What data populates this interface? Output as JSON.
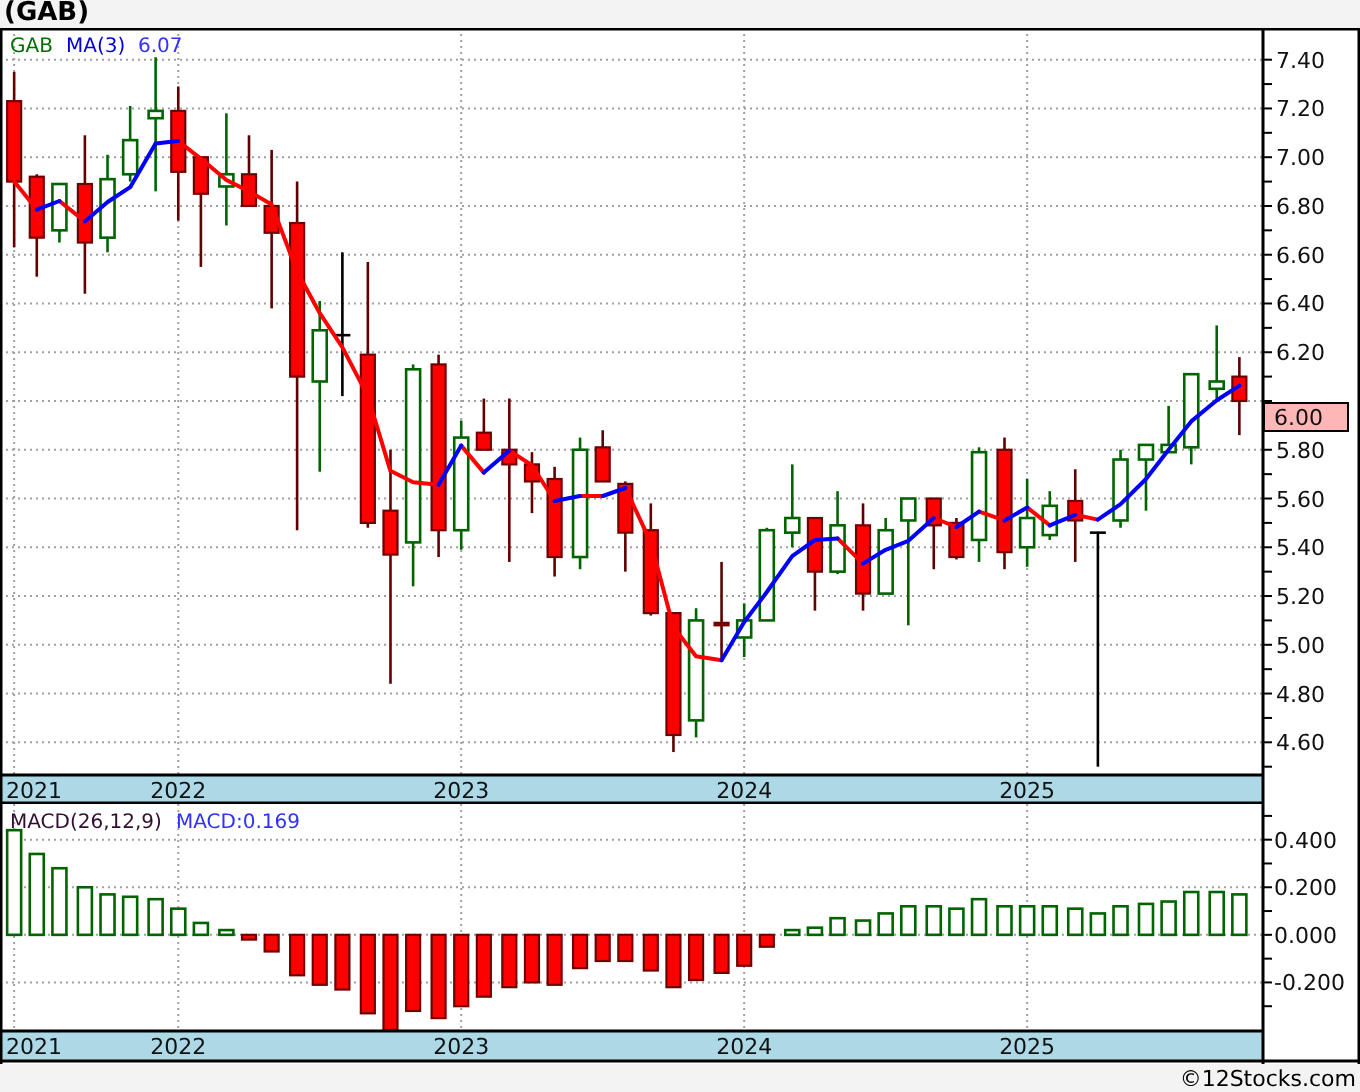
{
  "title": "(GAB)",
  "price_chart": {
    "legend": {
      "symbol": "GAB",
      "indicator": "MA(3)",
      "reading": "6.07"
    },
    "last_price": "6.00",
    "chart_data": {
      "type": "candlestick",
      "grid": true,
      "xlim": [
        2021.37,
        2025.83
      ],
      "ylim": [
        4.47,
        7.53
      ],
      "x": [
        2021.42,
        2021.5,
        2021.58,
        2021.67,
        2021.75,
        2021.83,
        2021.92,
        2022,
        2022.08,
        2022.17,
        2022.25,
        2022.33,
        2022.42,
        2022.5,
        2022.58,
        2022.67,
        2022.75,
        2022.83,
        2022.92,
        2023,
        2023.08,
        2023.17,
        2023.25,
        2023.33,
        2023.42,
        2023.5,
        2023.58,
        2023.67,
        2023.75,
        2023.83,
        2023.92,
        2024,
        2024.08,
        2024.17,
        2024.25,
        2024.33,
        2024.42,
        2024.5,
        2024.58,
        2024.67,
        2024.75,
        2024.83,
        2024.92,
        2025,
        2025.08,
        2025.17,
        2025.25,
        2025.33,
        2025.42,
        2025.5,
        2025.58,
        2025.67,
        2025.75
      ],
      "ohlc": [
        [
          7.23,
          7.35,
          6.63,
          6.9
        ],
        [
          6.92,
          6.93,
          6.51,
          6.67
        ],
        [
          6.7,
          6.89,
          6.65,
          6.89
        ],
        [
          6.89,
          7.09,
          6.44,
          6.65
        ],
        [
          6.67,
          7.01,
          6.61,
          6.91
        ],
        [
          6.93,
          7.21,
          6.9,
          7.07
        ],
        [
          7.16,
          7.41,
          6.86,
          7.19
        ],
        [
          7.19,
          7.29,
          6.74,
          6.94
        ],
        [
          7.0,
          7.0,
          6.55,
          6.85
        ],
        [
          6.88,
          7.18,
          6.72,
          6.93
        ],
        [
          6.93,
          7.09,
          6.8,
          6.8
        ],
        [
          6.8,
          7.03,
          6.38,
          6.69
        ],
        [
          6.73,
          6.9,
          5.47,
          6.1
        ],
        [
          6.08,
          6.41,
          5.71,
          6.29
        ],
        [
          6.27,
          6.61,
          6.02,
          6.27
        ],
        [
          6.19,
          6.57,
          5.48,
          5.5
        ],
        [
          5.55,
          5.8,
          4.84,
          5.37
        ],
        [
          5.42,
          6.15,
          5.24,
          6.13
        ],
        [
          6.15,
          6.19,
          5.36,
          5.47
        ],
        [
          5.47,
          5.92,
          5.39,
          5.85
        ],
        [
          5.87,
          6.01,
          5.8,
          5.8
        ],
        [
          5.8,
          6.01,
          5.34,
          5.74
        ],
        [
          5.74,
          5.79,
          5.54,
          5.67
        ],
        [
          5.68,
          5.73,
          5.28,
          5.36
        ],
        [
          5.36,
          5.85,
          5.31,
          5.8
        ],
        [
          5.81,
          5.88,
          5.67,
          5.67
        ],
        [
          5.66,
          5.67,
          5.3,
          5.46
        ],
        [
          5.47,
          5.58,
          5.12,
          5.13
        ],
        [
          5.13,
          5.13,
          4.56,
          4.63
        ],
        [
          4.69,
          5.15,
          4.62,
          5.1
        ],
        [
          5.09,
          5.34,
          4.94,
          5.08
        ],
        [
          5.03,
          5.17,
          4.95,
          5.1
        ],
        [
          5.1,
          5.48,
          5.1,
          5.47
        ],
        [
          5.46,
          5.74,
          5.4,
          5.52
        ],
        [
          5.52,
          5.52,
          5.14,
          5.3
        ],
        [
          5.3,
          5.63,
          5.29,
          5.49
        ],
        [
          5.49,
          5.58,
          5.14,
          5.21
        ],
        [
          5.21,
          5.52,
          5.21,
          5.47
        ],
        [
          5.51,
          5.6,
          5.08,
          5.6
        ],
        [
          5.6,
          5.6,
          5.31,
          5.49
        ],
        [
          5.5,
          5.52,
          5.35,
          5.36
        ],
        [
          5.43,
          5.81,
          5.34,
          5.79
        ],
        [
          5.8,
          5.85,
          5.31,
          5.38
        ],
        [
          5.4,
          5.68,
          5.32,
          5.52
        ],
        [
          5.45,
          5.63,
          5.43,
          5.57
        ],
        [
          5.59,
          5.72,
          5.34,
          5.51
        ],
        [
          5.46,
          5.46,
          4.5,
          5.46
        ],
        [
          5.51,
          5.8,
          5.48,
          5.76
        ],
        [
          5.76,
          5.82,
          5.55,
          5.82
        ],
        [
          5.79,
          5.98,
          5.79,
          5.82
        ],
        [
          5.81,
          6.11,
          5.74,
          6.11
        ],
        [
          6.05,
          6.31,
          6.01,
          6.08
        ],
        [
          6.1,
          6.18,
          5.86,
          6.0
        ]
      ],
      "xticks": [
        {
          "value": 2021.42,
          "label": "2021"
        },
        {
          "value": 2022,
          "label": "2022"
        },
        {
          "value": 2023,
          "label": "2023"
        },
        {
          "value": 2024,
          "label": "2024"
        },
        {
          "value": 2025,
          "label": "2025"
        }
      ],
      "yticks": [
        {
          "value": 7.4,
          "label": "7.40"
        },
        {
          "value": 7.2,
          "label": "7.20"
        },
        {
          "value": 7.0,
          "label": "7.00"
        },
        {
          "value": 6.8,
          "label": "6.80"
        },
        {
          "value": 6.6,
          "label": "6.60"
        },
        {
          "value": 6.4,
          "label": "6.40"
        },
        {
          "value": 6.2,
          "label": "6.20"
        },
        {
          "value": 5.8,
          "label": "5.80"
        },
        {
          "value": 5.6,
          "label": "5.60"
        },
        {
          "value": 5.4,
          "label": "5.40"
        },
        {
          "value": 5.2,
          "label": "5.20"
        },
        {
          "value": 5.0,
          "label": "5.00"
        },
        {
          "value": 4.8,
          "label": "4.80"
        },
        {
          "value": 4.6,
          "label": "4.60"
        }
      ]
    }
  },
  "macd_chart": {
    "legend": {
      "indicator": "MACD(26,12,9)",
      "reading": "MACD:0.169"
    },
    "chart_data": {
      "type": "bar",
      "grid": true,
      "xlim": [
        2021.37,
        2025.83
      ],
      "ylim": [
        -0.4,
        0.55
      ],
      "x": [
        2021.42,
        2021.5,
        2021.58,
        2021.67,
        2021.75,
        2021.83,
        2021.92,
        2022,
        2022.08,
        2022.17,
        2022.25,
        2022.33,
        2022.42,
        2022.5,
        2022.58,
        2022.67,
        2022.75,
        2022.83,
        2022.92,
        2023,
        2023.08,
        2023.17,
        2023.25,
        2023.33,
        2023.42,
        2023.5,
        2023.58,
        2023.67,
        2023.75,
        2023.83,
        2023.92,
        2024,
        2024.08,
        2024.17,
        2024.25,
        2024.33,
        2024.42,
        2024.5,
        2024.58,
        2024.67,
        2024.75,
        2024.83,
        2024.92,
        2025,
        2025.08,
        2025.17,
        2025.25,
        2025.33,
        2025.42,
        2025.5,
        2025.58,
        2025.67,
        2025.75
      ],
      "values": [
        0.44,
        0.34,
        0.28,
        0.2,
        0.17,
        0.16,
        0.15,
        0.11,
        0.05,
        0.02,
        -0.02,
        -0.07,
        -0.17,
        -0.21,
        -0.23,
        -0.33,
        -0.4,
        -0.32,
        -0.35,
        -0.3,
        -0.26,
        -0.22,
        -0.2,
        -0.21,
        -0.14,
        -0.11,
        -0.11,
        -0.15,
        -0.22,
        -0.19,
        -0.16,
        -0.13,
        -0.05,
        0.02,
        0.03,
        0.07,
        0.06,
        0.09,
        0.12,
        0.12,
        0.11,
        0.15,
        0.12,
        0.12,
        0.12,
        0.11,
        0.09,
        0.12,
        0.13,
        0.14,
        0.18,
        0.18,
        0.17
      ],
      "xticks": [
        {
          "value": 2021.42,
          "label": "2021"
        },
        {
          "value": 2022,
          "label": "2022"
        },
        {
          "value": 2023,
          "label": "2023"
        },
        {
          "value": 2024,
          "label": "2024"
        },
        {
          "value": 2025,
          "label": "2025"
        }
      ],
      "yticks": [
        {
          "value": 0.4,
          "label": "0.400"
        },
        {
          "value": 0.2,
          "label": "0.200"
        },
        {
          "value": 0.0,
          "label": "0.000"
        },
        {
          "value": -0.2,
          "label": "-0.200"
        }
      ]
    }
  },
  "footer": "©12Stocks.com"
}
